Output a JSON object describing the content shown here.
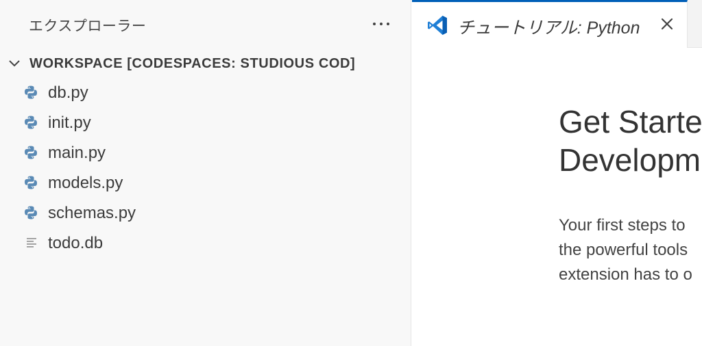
{
  "sidebar": {
    "title": "エクスプローラー",
    "workspace_label": "WORKSPACE [CODESPACES: STUDIOUS COD]",
    "files": [
      {
        "name": "db.py",
        "icon": "python-icon"
      },
      {
        "name": "init.py",
        "icon": "python-icon"
      },
      {
        "name": "main.py",
        "icon": "python-icon"
      },
      {
        "name": "models.py",
        "icon": "python-icon"
      },
      {
        "name": "schemas.py",
        "icon": "python-icon"
      },
      {
        "name": "todo.db",
        "icon": "text-file-icon"
      }
    ]
  },
  "tab": {
    "label": "チュートリアル: Python",
    "icon": "vscode-icon"
  },
  "editor": {
    "title_lines": [
      "Get Starte",
      "Developm"
    ],
    "desc_lines": [
      "Your first steps to",
      "the powerful tools",
      "extension has to o"
    ]
  },
  "colors": {
    "sidebar_bg": "#f8f8f8",
    "accent": "#005fb8",
    "python_icon": "#5a8ab5"
  }
}
